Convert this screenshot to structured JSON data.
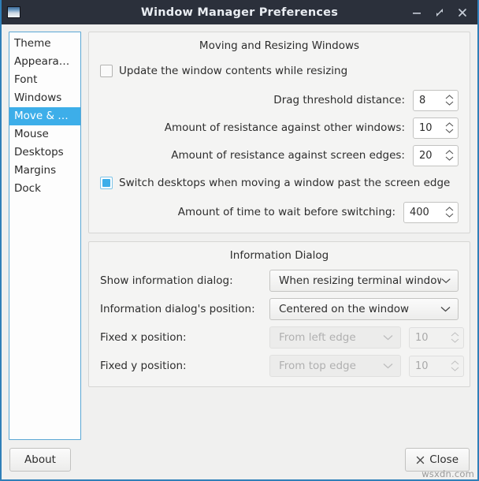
{
  "window": {
    "title": "Window Manager Preferences",
    "icon": "window-icon",
    "controls": [
      {
        "name": "minimize-button",
        "glyph": "minimize-icon"
      },
      {
        "name": "maximize-button",
        "glyph": "maximize-icon"
      },
      {
        "name": "close-button",
        "glyph": "close-icon"
      }
    ]
  },
  "sidebar": {
    "items": [
      {
        "label": "Theme",
        "selected": false
      },
      {
        "label": "Appeara…",
        "selected": false
      },
      {
        "label": "Font",
        "selected": false
      },
      {
        "label": "Windows",
        "selected": false
      },
      {
        "label": "Move & …",
        "selected": true
      },
      {
        "label": "Mouse",
        "selected": false
      },
      {
        "label": "Desktops",
        "selected": false
      },
      {
        "label": "Margins",
        "selected": false
      },
      {
        "label": "Dock",
        "selected": false
      }
    ]
  },
  "moving_section": {
    "title": "Moving and Resizing Windows",
    "update_contents": {
      "label": "Update the window contents while resizing",
      "checked": false
    },
    "drag_threshold": {
      "label": "Drag threshold distance:",
      "value": "8"
    },
    "resistance_windows": {
      "label": "Amount of resistance against other windows:",
      "value": "10"
    },
    "resistance_edges": {
      "label": "Amount of resistance against screen edges:",
      "value": "20"
    },
    "switch_desktops": {
      "label": "Switch desktops when moving a window past the screen edge",
      "checked": true
    },
    "wait_time": {
      "label": "Amount of time to wait before switching:",
      "value": "400"
    }
  },
  "info_section": {
    "title": "Information Dialog",
    "show_dialog": {
      "label": "Show information dialog:",
      "value": "When resizing terminal windows"
    },
    "dialog_position": {
      "label": "Information dialog's position:",
      "value": "Centered on the window"
    },
    "fixed_x": {
      "label": "Fixed x position:",
      "combo_value": "From left edge",
      "spin_value": "10",
      "disabled": true
    },
    "fixed_y": {
      "label": "Fixed y position:",
      "combo_value": "From top edge",
      "spin_value": "10",
      "disabled": true
    }
  },
  "footer": {
    "about_label": "About",
    "close_label": "Close",
    "close_icon": "close-x-icon"
  },
  "watermark": "wsxdn.com",
  "colors": {
    "titlebar": "#2b303b",
    "selection": "#3daee9",
    "window_border": "#2f7fb8",
    "panel_bg": "#f4f4f3"
  }
}
